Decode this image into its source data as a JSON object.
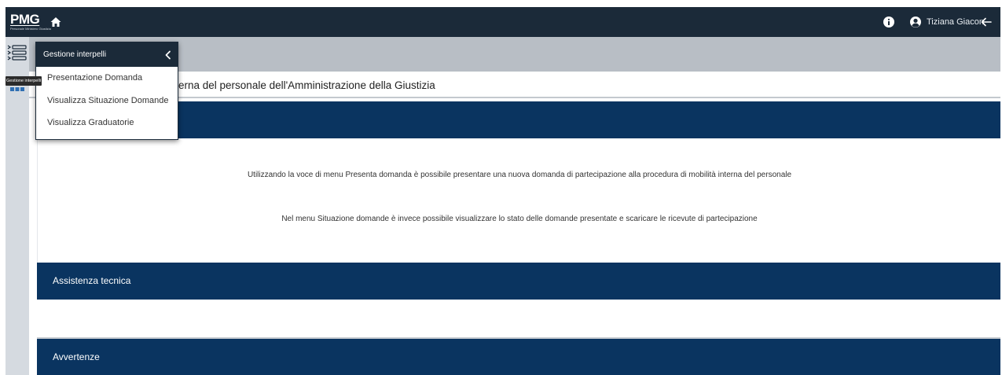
{
  "navbar": {
    "logo_text": "PMG",
    "logo_subtitle": "Personale Ministero Giustizia",
    "user_name": "Tiziana Giacon",
    "icons": {
      "home": "home-icon",
      "info": "info-icon",
      "user": "user-circle-icon",
      "logout": "arrow-left-icon"
    }
  },
  "sidebar": {
    "toggle_icon": "menu-list-icon",
    "tooltip": "Gestione interpelli"
  },
  "menu": {
    "title": "Gestione interpelli",
    "items": [
      {
        "label": "Presentazione Domanda"
      },
      {
        "label": "Visualizza Situazione Domande"
      },
      {
        "label": "Visualizza Graduatorie"
      }
    ]
  },
  "page": {
    "title_visible": "erna del personale dell'Amministrazione della Giustizia",
    "paragraph_1": "Utilizzando la voce di menu Presenta domanda è possibile presentare una nuova domanda di partecipazione alla procedura di mobilità interna del personale",
    "paragraph_2": "Nel menu Situazione domande è invece possibile visualizzare lo stato delle domande presentate e scaricare le ricevute di partecipazione",
    "section_assistance": "Assistenza tecnica",
    "section_warnings": "Avvertenze"
  },
  "colors": {
    "navbar": "#1b2a39",
    "band": "#0a3460",
    "subbar": "#b8bec5",
    "sidebar": "#d5dae0"
  }
}
